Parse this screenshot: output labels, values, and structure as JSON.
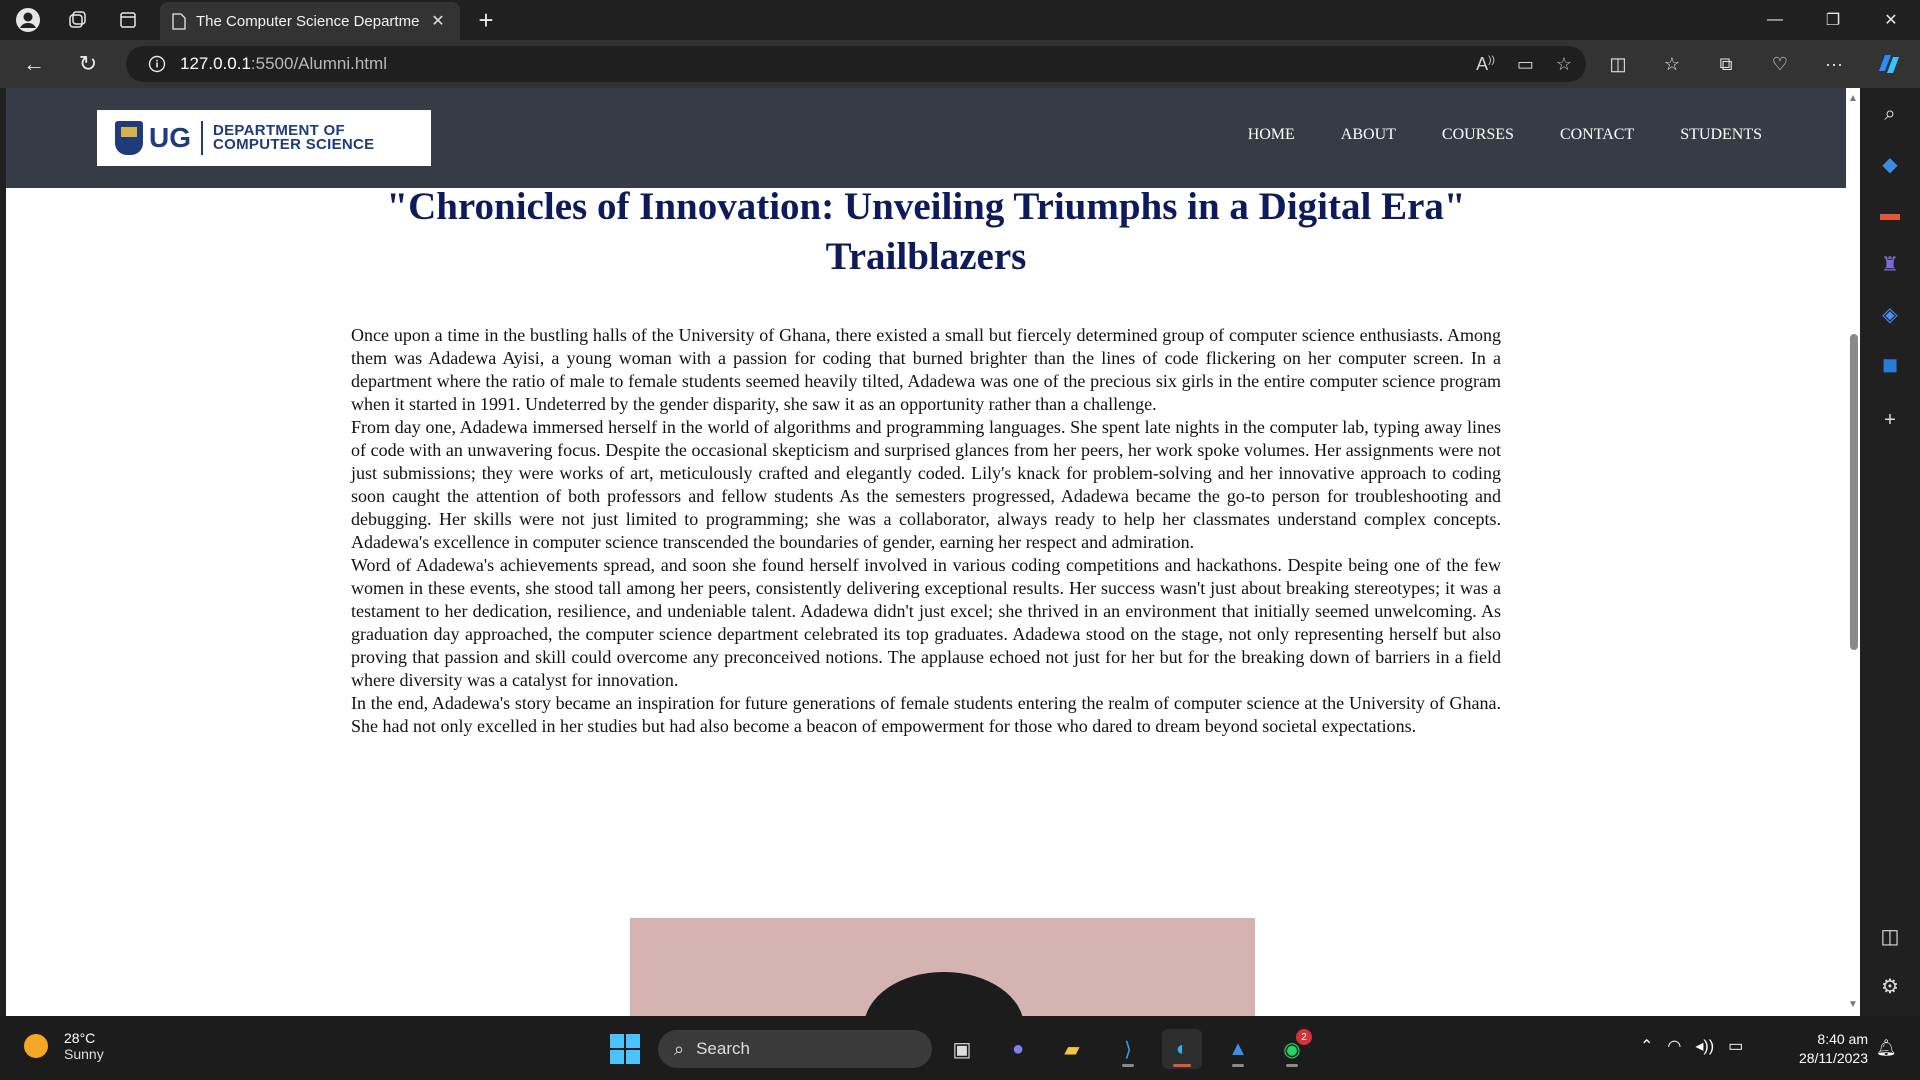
{
  "browser": {
    "tab_title": "The Computer Science Departme",
    "url_host": "127.0.0.1",
    "url_path": ":5500/Alumni.html"
  },
  "site": {
    "logo_ug": "UG",
    "logo_line1": "DEPARTMENT OF",
    "logo_line2": "COMPUTER SCIENCE",
    "nav": [
      "HOME",
      "ABOUT",
      "COURSES",
      "CONTACT",
      "STUDENTS"
    ]
  },
  "article": {
    "title_line1": "\"Chronicles of Innovation: Unveiling Triumphs in a Digital Era\"",
    "title_line2": "Trailblazers",
    "paragraphs": [
      "Once upon a time in the bustling halls of the University of Ghana, there existed a small but fiercely determined group of computer science enthusiasts. Among them was Adadewa Ayisi, a young woman with a passion for coding that burned brighter than the lines of code flickering on her computer screen. In a department where the ratio of male to female students seemed heavily tilted, Adadewa was one of the precious six girls in the entire computer science program when it started in 1991. Undeterred by the gender disparity, she saw it as an opportunity rather than a challenge.",
      "From day one, Adadewa immersed herself in the world of algorithms and programming languages. She spent late nights in the computer lab, typing away lines of code with an unwavering focus. Despite the occasional skepticism and surprised glances from her peers, her work spoke volumes. Her assignments were not just submissions; they were works of art, meticulously crafted and elegantly coded. Lily's knack for problem-solving and her innovative approach to coding soon caught the attention of both professors and fellow students As the semesters progressed, Adadewa became the go-to person for troubleshooting and debugging. Her skills were not just limited to programming; she was a collaborator, always ready to help her classmates understand complex concepts. Adadewa's excellence in computer science transcended the boundaries of gender, earning her respect and admiration.",
      "Word of Adadewa's achievements spread, and soon she found herself involved in various coding competitions and hackathons. Despite being one of the few women in these events, she stood tall among her peers, consistently delivering exceptional results. Her success wasn't just about breaking stereotypes; it was a testament to her dedication, resilience, and undeniable talent. Adadewa didn't just excel; she thrived in an environment that initially seemed unwelcoming. As graduation day approached, the computer science department celebrated its top graduates. Adadewa stood on the stage, not only representing herself but also proving that passion and skill could overcome any preconceived notions. The applause echoed not just for her but for the breaking down of barriers in a field where diversity was a catalyst for innovation.",
      "In the end, Adadewa's story became an inspiration for future generations of female students entering the realm of computer science at the University of Ghana. She had not only excelled in her studies but had also become a beacon of empowerment for those who dared to dream beyond societal expectations."
    ]
  },
  "taskbar": {
    "temperature": "28°C",
    "weather": "Sunny",
    "search_placeholder": "Search",
    "whatsapp_badge": "2",
    "time": "8:40 am",
    "date": "28/11/2023"
  },
  "colors": {
    "header_bg": "#373b45",
    "title_color": "#0d1a5c",
    "photo_bg": "#d5b3b0"
  }
}
